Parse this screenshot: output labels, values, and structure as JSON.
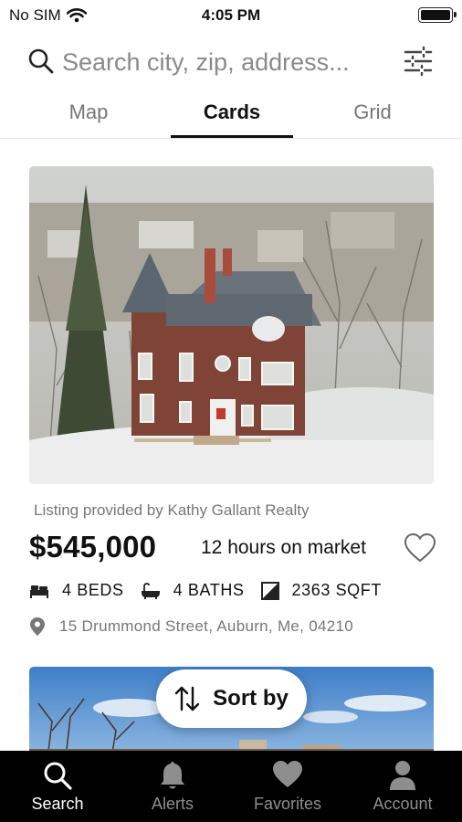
{
  "status_bar": {
    "carrier": "No SIM",
    "time": "4:05 PM",
    "icons": [
      "wifi-icon",
      "battery-icon"
    ]
  },
  "search": {
    "placeholder": "Search city, zip, address...",
    "value": "",
    "search_icon": "search-icon",
    "filter_icon": "filter-sliders-icon"
  },
  "tabs": [
    {
      "label": "Map",
      "active": false
    },
    {
      "label": "Cards",
      "active": true
    },
    {
      "label": "Grid",
      "active": false
    }
  ],
  "listing": {
    "provider": "Listing provided by Kathy Gallant Realty",
    "price": "$545,000",
    "market_time": "12 hours on market",
    "favorite_icon": "heart-outline-icon",
    "beds": "4 BEDS",
    "baths": "4 BATHS",
    "sqft": "2363 SQFT",
    "address": "15 Drummond Street, Auburn, Me, 04210"
  },
  "sort": {
    "label": "Sort by",
    "icon": "sort-arrows-icon"
  },
  "bottom_nav": [
    {
      "label": "Search",
      "icon": "search-icon",
      "active": true
    },
    {
      "label": "Alerts",
      "icon": "bell-icon",
      "active": false
    },
    {
      "label": "Favorites",
      "icon": "heart-icon",
      "active": false
    },
    {
      "label": "Account",
      "icon": "person-icon",
      "active": false
    }
  ],
  "colors": {
    "text_primary": "#111111",
    "text_secondary": "#777777",
    "nav_background": "#000000",
    "nav_active": "#ffffff",
    "nav_inactive": "#8e8e8e"
  }
}
